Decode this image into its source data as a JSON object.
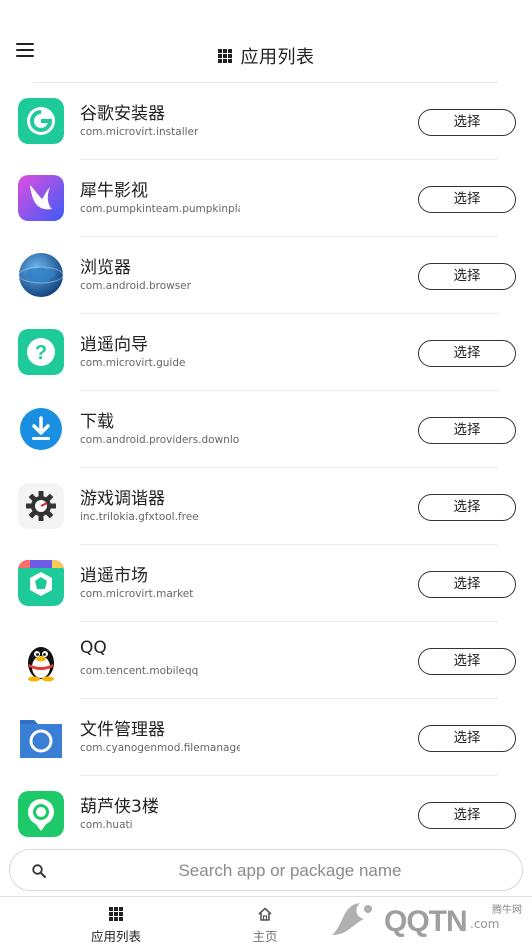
{
  "header": {
    "title": "应用列表",
    "menu_icon": "hamburger-menu-icon",
    "title_icon": "grid-icon"
  },
  "apps": [
    {
      "name": "谷歌安装器",
      "package": "com.microvirt.installer",
      "icon": "google-installer-icon",
      "color": "#1ec99a"
    },
    {
      "name": "犀牛影视",
      "package": "com.pumpkinteam.pumpkinplay",
      "icon": "rhino-video-icon",
      "color": "#7b4cf0"
    },
    {
      "name": "浏览器",
      "package": "com.android.browser",
      "icon": "globe-icon",
      "color": "#1c5fa8"
    },
    {
      "name": "逍遥向导",
      "package": "com.microvirt.guide",
      "icon": "help-question-icon",
      "color": "#1ec99a"
    },
    {
      "name": "下载",
      "package": "com.android.providers.downloads",
      "icon": "download-icon",
      "color": "#1a8ee0"
    },
    {
      "name": "游戏调谐器",
      "package": "inc.trilokia.gfxtool.free",
      "icon": "gear-tuner-icon",
      "color": "#333333"
    },
    {
      "name": "逍遥市场",
      "package": "com.microvirt.market",
      "icon": "market-bag-icon",
      "color": "#1ec99a"
    },
    {
      "name": "QQ",
      "package": "com.tencent.mobileqq",
      "icon": "qq-penguin-icon",
      "color": "#111111"
    },
    {
      "name": "文件管理器",
      "package": "com.cyanogenmod.filemanager",
      "icon": "folder-icon",
      "color": "#2f6fc6"
    },
    {
      "name": "葫芦侠3楼",
      "package": "com.huati",
      "icon": "gourd-icon",
      "color": "#1ec96a"
    }
  ],
  "select_label": "选择",
  "search": {
    "placeholder": "Search app or package name",
    "icon": "search-icon"
  },
  "bottom_nav": [
    {
      "label": "应用列表",
      "icon": "grid-icon",
      "active": true
    },
    {
      "label": "主页",
      "icon": "home-icon",
      "active": false
    }
  ],
  "watermark": {
    "small_text": "腾牛网",
    "big_text": "QQTN",
    "suffix": ".com"
  }
}
